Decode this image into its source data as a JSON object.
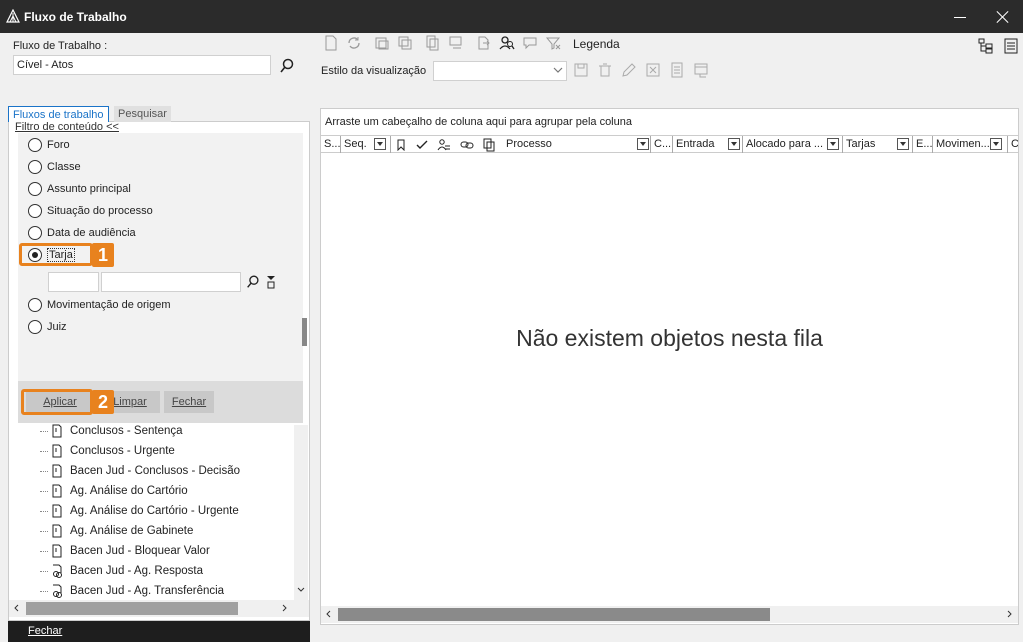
{
  "window": {
    "title": "Fluxo de Trabalho"
  },
  "top": {
    "workflow_label": "Fluxo de Trabalho :",
    "workflow_value": "Cível - Atos",
    "legend_label": "Legenda",
    "view_style_label": "Estilo da visualização",
    "view_style_value": ""
  },
  "left": {
    "tabs": [
      "Fluxos de trabalho",
      "Pesquisar"
    ],
    "filter_link": "Filtro de conteúdo <<",
    "filter_options": [
      {
        "label": "Foro",
        "checked": false
      },
      {
        "label": "Classe",
        "checked": false
      },
      {
        "label": "Assunto principal",
        "checked": false
      },
      {
        "label": "Situação do processo",
        "checked": false
      },
      {
        "label": "Data de audiência",
        "checked": false
      },
      {
        "label": "Tarja",
        "checked": true
      },
      {
        "label": "Movimentação de origem",
        "checked": false
      },
      {
        "label": "Juiz",
        "checked": false
      }
    ],
    "buttons": {
      "apply": "Aplicar",
      "clear": "Limpar",
      "close": "Fechar"
    },
    "callouts": [
      "1",
      "2"
    ],
    "tree_items": [
      "Conclusos - Sentença",
      "Conclusos - Urgente",
      "Bacen Jud - Conclusos - Decisão",
      "Ag. Análise do Cartório",
      "Ag. Análise do Cartório - Urgente",
      "Ag. Análise de Gabinete",
      "Bacen Jud - Bloquear Valor",
      "Bacen Jud - Ag. Resposta",
      "Bacen Jud - Ag. Transferência"
    ],
    "footer_button": "Fechar"
  },
  "grid": {
    "group_hint": "Arraste um cabeçalho de coluna aqui para agrupar pela coluna",
    "columns": [
      "S...",
      "Seq.",
      "Processo",
      "C...",
      "Entrada",
      "Alocado para ...",
      "Tarjas",
      "E...",
      "Movimen...",
      "C"
    ],
    "empty_message": "Não existem objetos nesta fila"
  }
}
